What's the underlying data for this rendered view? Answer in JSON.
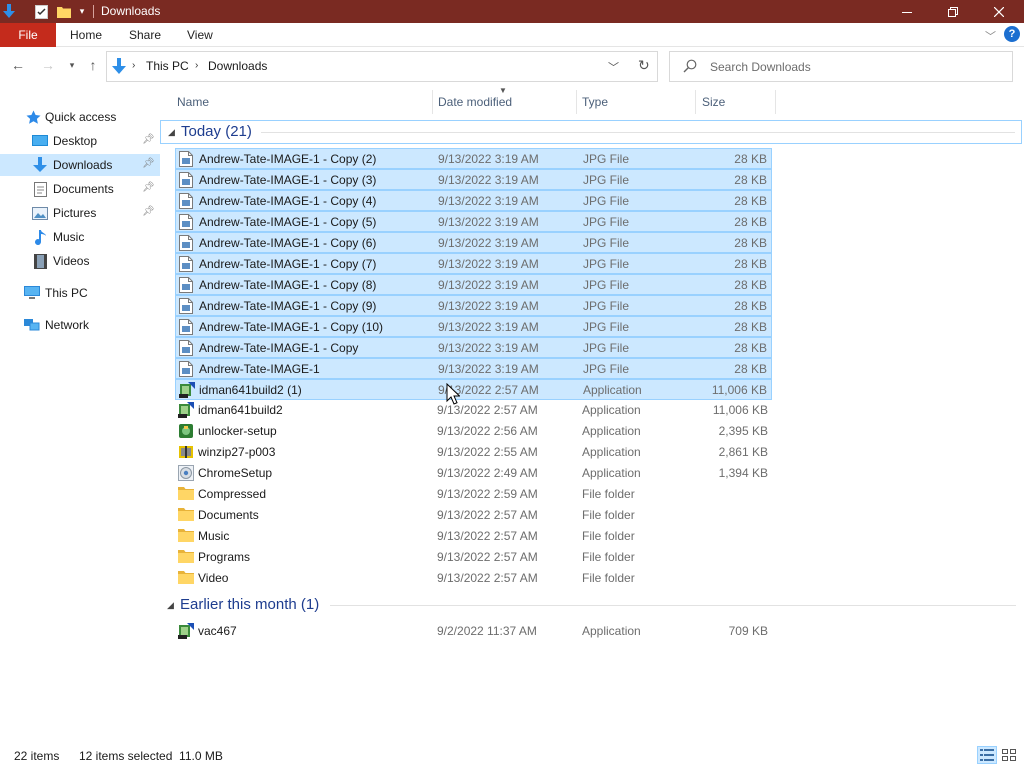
{
  "window": {
    "title": "Downloads"
  },
  "ribbon": {
    "tabs": [
      "File",
      "Home",
      "Share",
      "View"
    ]
  },
  "address": {
    "breadcrumbs": [
      "This PC",
      "Downloads"
    ],
    "search_placeholder": "Search Downloads"
  },
  "nav": {
    "items": [
      {
        "label": "Quick access",
        "icon": "star-icon",
        "pinned": false,
        "selected": false
      },
      {
        "label": "Desktop",
        "icon": "desktop-icon",
        "pinned": true,
        "selected": false
      },
      {
        "label": "Downloads",
        "icon": "download-arrow-icon",
        "pinned": true,
        "selected": true
      },
      {
        "label": "Documents",
        "icon": "documents-icon",
        "pinned": true,
        "selected": false
      },
      {
        "label": "Pictures",
        "icon": "pictures-icon",
        "pinned": true,
        "selected": false
      },
      {
        "label": "Music",
        "icon": "music-note-icon",
        "pinned": false,
        "selected": false
      },
      {
        "label": "Videos",
        "icon": "film-icon",
        "pinned": false,
        "selected": false
      },
      {
        "label": "This PC",
        "icon": "computer-icon",
        "pinned": false,
        "selected": false
      },
      {
        "label": "Network",
        "icon": "network-icon",
        "pinned": false,
        "selected": false
      }
    ]
  },
  "columns": {
    "name": "Name",
    "date": "Date modified",
    "type": "Type",
    "size": "Size"
  },
  "groups": [
    {
      "title": "Today (21)",
      "files": [
        {
          "name": "Andrew-Tate-IMAGE-1 - Copy (2)",
          "date": "9/13/2022 3:19 AM",
          "type": "JPG File",
          "size": "28 KB",
          "icon": "jpg-file-icon",
          "selected": true
        },
        {
          "name": "Andrew-Tate-IMAGE-1 - Copy (3)",
          "date": "9/13/2022 3:19 AM",
          "type": "JPG File",
          "size": "28 KB",
          "icon": "jpg-file-icon",
          "selected": true
        },
        {
          "name": "Andrew-Tate-IMAGE-1 - Copy (4)",
          "date": "9/13/2022 3:19 AM",
          "type": "JPG File",
          "size": "28 KB",
          "icon": "jpg-file-icon",
          "selected": true
        },
        {
          "name": "Andrew-Tate-IMAGE-1 - Copy (5)",
          "date": "9/13/2022 3:19 AM",
          "type": "JPG File",
          "size": "28 KB",
          "icon": "jpg-file-icon",
          "selected": true
        },
        {
          "name": "Andrew-Tate-IMAGE-1 - Copy (6)",
          "date": "9/13/2022 3:19 AM",
          "type": "JPG File",
          "size": "28 KB",
          "icon": "jpg-file-icon",
          "selected": true
        },
        {
          "name": "Andrew-Tate-IMAGE-1 - Copy (7)",
          "date": "9/13/2022 3:19 AM",
          "type": "JPG File",
          "size": "28 KB",
          "icon": "jpg-file-icon",
          "selected": true
        },
        {
          "name": "Andrew-Tate-IMAGE-1 - Copy (8)",
          "date": "9/13/2022 3:19 AM",
          "type": "JPG File",
          "size": "28 KB",
          "icon": "jpg-file-icon",
          "selected": true
        },
        {
          "name": "Andrew-Tate-IMAGE-1 - Copy (9)",
          "date": "9/13/2022 3:19 AM",
          "type": "JPG File",
          "size": "28 KB",
          "icon": "jpg-file-icon",
          "selected": true
        },
        {
          "name": "Andrew-Tate-IMAGE-1 - Copy (10)",
          "date": "9/13/2022 3:19 AM",
          "type": "JPG File",
          "size": "28 KB",
          "icon": "jpg-file-icon",
          "selected": true
        },
        {
          "name": "Andrew-Tate-IMAGE-1 - Copy",
          "date": "9/13/2022 3:19 AM",
          "type": "JPG File",
          "size": "28 KB",
          "icon": "jpg-file-icon",
          "selected": true
        },
        {
          "name": "Andrew-Tate-IMAGE-1",
          "date": "9/13/2022 3:19 AM",
          "type": "JPG File",
          "size": "28 KB",
          "icon": "jpg-file-icon",
          "selected": true
        },
        {
          "name": "idman641build2 (1)",
          "date": "9/13/2022 2:57 AM",
          "type": "Application",
          "size": "11,006 KB",
          "icon": "installer-app-icon",
          "selected": true
        },
        {
          "name": "idman641build2",
          "date": "9/13/2022 2:57 AM",
          "type": "Application",
          "size": "11,006 KB",
          "icon": "installer-app-icon",
          "selected": false
        },
        {
          "name": "unlocker-setup",
          "date": "9/13/2022 2:56 AM",
          "type": "Application",
          "size": "2,395 KB",
          "icon": "setup-app-icon",
          "selected": false
        },
        {
          "name": "winzip27-p003",
          "date": "9/13/2022 2:55 AM",
          "type": "Application",
          "size": "2,861 KB",
          "icon": "winzip-app-icon",
          "selected": false
        },
        {
          "name": "ChromeSetup",
          "date": "9/13/2022 2:49 AM",
          "type": "Application",
          "size": "1,394 KB",
          "icon": "chrome-app-icon",
          "selected": false
        },
        {
          "name": "Compressed",
          "date": "9/13/2022 2:59 AM",
          "type": "File folder",
          "size": "",
          "icon": "folder-icon",
          "selected": false
        },
        {
          "name": "Documents",
          "date": "9/13/2022 2:57 AM",
          "type": "File folder",
          "size": "",
          "icon": "folder-icon",
          "selected": false
        },
        {
          "name": "Music",
          "date": "9/13/2022 2:57 AM",
          "type": "File folder",
          "size": "",
          "icon": "folder-icon",
          "selected": false
        },
        {
          "name": "Programs",
          "date": "9/13/2022 2:57 AM",
          "type": "File folder",
          "size": "",
          "icon": "folder-icon",
          "selected": false
        },
        {
          "name": "Video",
          "date": "9/13/2022 2:57 AM",
          "type": "File folder",
          "size": "",
          "icon": "folder-icon",
          "selected": false
        }
      ]
    },
    {
      "title": "Earlier this month (1)",
      "files": [
        {
          "name": "vac467",
          "date": "9/2/2022 11:37 AM",
          "type": "Application",
          "size": "709 KB",
          "icon": "installer-app-icon",
          "selected": false
        }
      ]
    }
  ],
  "status": {
    "item_count": "22 items",
    "selection": "12 items selected  11.0 MB"
  },
  "colors": {
    "titlebar": "#7a2a22",
    "file_tab": "#c42b1c",
    "selection": "#cce8ff",
    "selection_border": "#99d1ff",
    "group_title": "#1e3d8f",
    "folder": "#ffd665"
  }
}
